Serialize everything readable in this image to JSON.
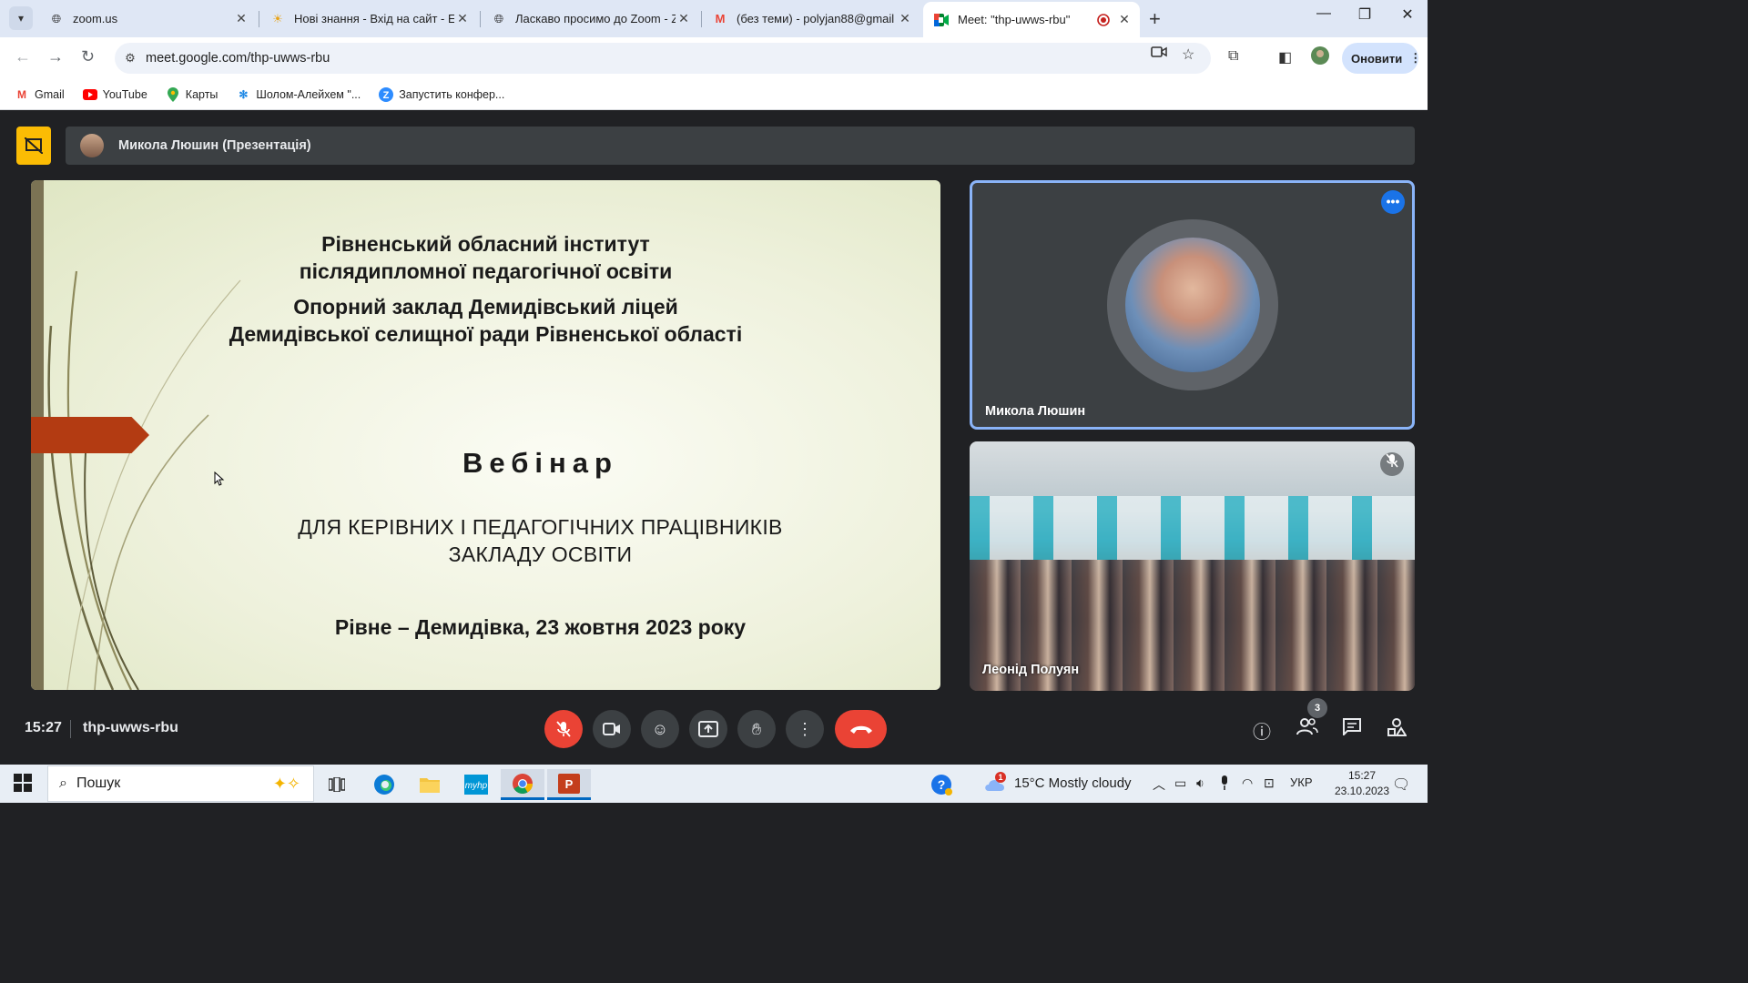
{
  "browser": {
    "tabs": [
      {
        "title": "zoom.us",
        "icon": "globe-icon"
      },
      {
        "title": "Нові знання - Вхід на сайт - Е",
        "icon": "sun-icon"
      },
      {
        "title": "Ласкаво просимо до Zoom - Z",
        "icon": "globe-icon"
      },
      {
        "title": "(без теми) - polyjan88@gmail",
        "icon": "gmail-icon"
      },
      {
        "title": "Meet: \"thp-uwws-rbu\"",
        "icon": "meet-icon",
        "active": true
      }
    ],
    "url": "meet.google.com/thp-uwws-rbu",
    "update_label": "Оновити",
    "bookmarks": [
      {
        "label": "Gmail",
        "icon": "gmail-icon"
      },
      {
        "label": "YouTube",
        "icon": "youtube-icon"
      },
      {
        "label": "Карты",
        "icon": "maps-pin-icon"
      },
      {
        "label": "Шолом-Алейхем \"...",
        "icon": "snowflake-icon"
      },
      {
        "label": "Запустить конфер...",
        "icon": "zoom-icon"
      }
    ]
  },
  "meet": {
    "presentation_title": "Микола Люшин (Презентація)",
    "slide": {
      "institute_line1": "Рівненський обласний інститут",
      "institute_line2": "післядипломної педагогічної освіти",
      "school_line1": "Опорний заклад Демидівський ліцей",
      "school_line2": "Демидівської селищної ради Рівненської області",
      "webinar": "Вебінар",
      "audience_line1": "ДЛЯ КЕРІВНИХ І ПЕДАГОГІЧНИХ ПРАЦІВНИКІВ",
      "audience_line2": "ЗАКЛАДУ  ОСВІТИ",
      "place_date": "Рівне – Демидівка, 23 жовтня 2023 року"
    },
    "participants": [
      {
        "name": "Микола Люшин",
        "speaking": true
      },
      {
        "name": "Леонід Полуян",
        "muted": true
      }
    ],
    "time": "15:27",
    "meeting_code": "thp-uwws-rbu",
    "participant_count": "3",
    "colors": {
      "end_call": "#ea4335",
      "accent": "#8ab4f8",
      "present": "#fbbc04"
    }
  },
  "taskbar": {
    "search_placeholder": "Пошук",
    "weather": "15°C  Mostly cloudy",
    "weather_alert": "1",
    "language": "УКР",
    "clock_time": "15:27",
    "clock_date": "23.10.2023"
  }
}
